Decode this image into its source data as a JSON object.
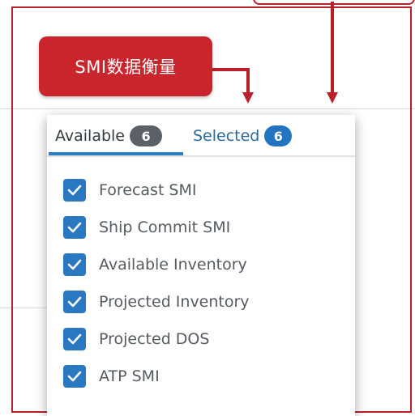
{
  "callout": {
    "label": "SMI数据衡量"
  },
  "tabs": {
    "available": {
      "label": "Available",
      "count": "6"
    },
    "selected": {
      "label": "Selected",
      "count": "6"
    }
  },
  "items": [
    {
      "label": "Forecast SMI",
      "checked": true
    },
    {
      "label": "Ship Commit SMI",
      "checked": true
    },
    {
      "label": "Available Inventory",
      "checked": true
    },
    {
      "label": "Projected Inventory",
      "checked": true
    },
    {
      "label": "Projected DOS",
      "checked": true
    },
    {
      "label": "ATP SMI",
      "checked": true
    }
  ],
  "colors": {
    "accent": "#2b78c2",
    "annotation": "#c8262c"
  }
}
